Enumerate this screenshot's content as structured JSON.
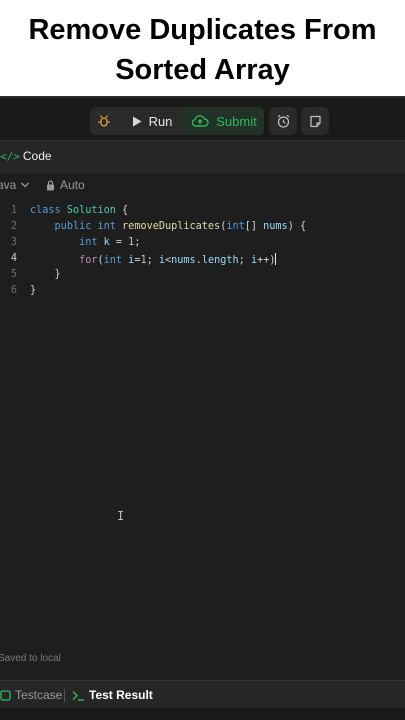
{
  "title": {
    "line1": "Remove Duplicates From",
    "line2": "Sorted Array"
  },
  "toolbar": {
    "run_label": "Run",
    "submit_label": "Submit"
  },
  "panel": {
    "tab_label": "Code",
    "language": "ava",
    "autocomplete": "Auto"
  },
  "editor": {
    "line_numbers": [
      "1",
      "2",
      "3",
      "4",
      "5",
      "6"
    ],
    "active_line": 4
  },
  "status": {
    "saved": "Saved to local"
  },
  "bottom_tabs": {
    "testcase": "Testcase",
    "test_result": "Test Result"
  },
  "colors": {
    "accent_green": "#2cbb5d",
    "background": "#1e1e1e"
  },
  "icons": [
    "debug-icon",
    "play-icon",
    "cloud-upload-icon",
    "alarm-clock-icon",
    "note-icon",
    "code-brackets-icon",
    "chevron-down-icon",
    "lock-icon",
    "checkbox-icon",
    "terminal-icon"
  ]
}
